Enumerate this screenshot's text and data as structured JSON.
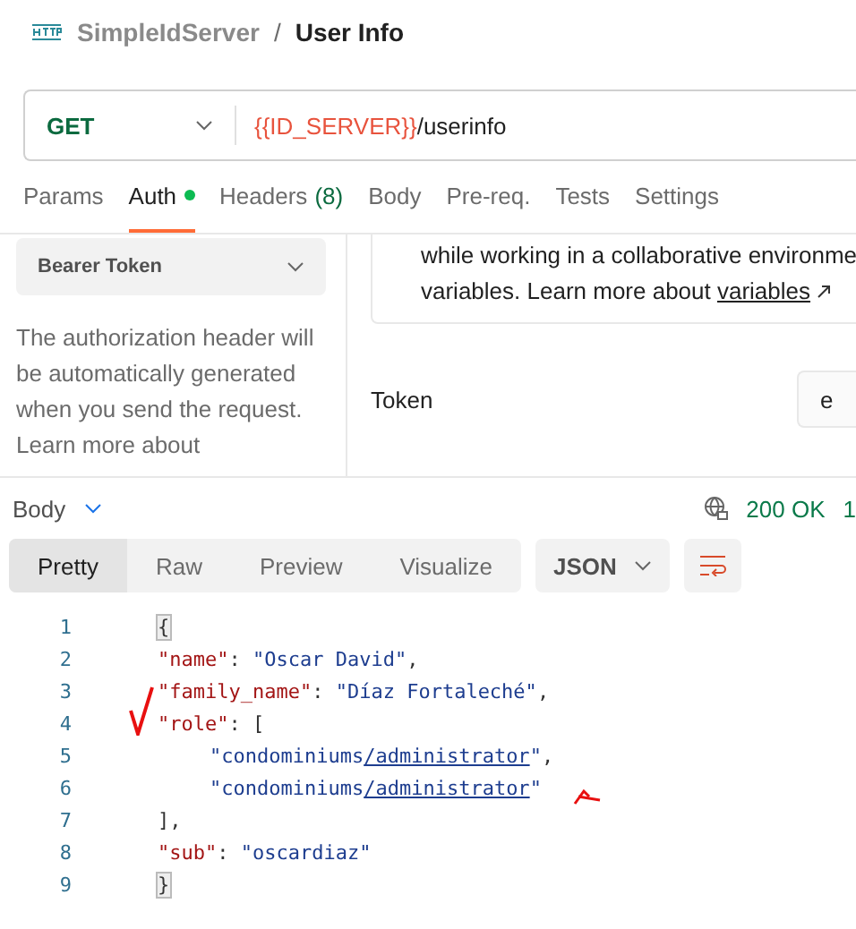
{
  "breadcrumb": {
    "collection": "SimpleIdServer",
    "separator": "/",
    "request": "User Info"
  },
  "request": {
    "method": "GET",
    "url_variable": "{{ID_SERVER}}",
    "url_path": "/userinfo"
  },
  "tabs": [
    {
      "label": "Params",
      "selected": false
    },
    {
      "label": "Auth",
      "selected": true,
      "dot": true
    },
    {
      "label": "Headers",
      "count": "(8)",
      "selected": false
    },
    {
      "label": "Body",
      "selected": false
    },
    {
      "label": "Pre-req.",
      "selected": false
    },
    {
      "label": "Tests",
      "selected": false
    },
    {
      "label": "Settings",
      "selected": false
    }
  ],
  "auth": {
    "type": "Bearer Token",
    "description": "The authorization header will be automatically generated when you send the request. Learn more about",
    "info_line_1": "while working in a collaborative environme",
    "info_line_2": "variables. Learn more about ",
    "info_link": "variables",
    "token_label": "Token",
    "token_value": "e"
  },
  "response": {
    "label": "Body",
    "status": "200 OK",
    "time": "1",
    "views": [
      {
        "label": "Pretty",
        "selected": true
      },
      {
        "label": "Raw",
        "selected": false
      },
      {
        "label": "Preview",
        "selected": false
      },
      {
        "label": "Visualize",
        "selected": false
      }
    ],
    "format": "JSON"
  },
  "code": [
    {
      "number": "1",
      "segments": [
        {
          "kind": "bracket",
          "text": "{"
        }
      ]
    },
    {
      "number": "2",
      "segments": [
        {
          "kind": "key",
          "text": "\"name\""
        },
        {
          "kind": "punct",
          "text": ": "
        },
        {
          "kind": "string",
          "text": "\"Oscar David\""
        },
        {
          "kind": "punct",
          "text": ","
        }
      ]
    },
    {
      "number": "3",
      "segments": [
        {
          "kind": "key",
          "text": "\"family_name\""
        },
        {
          "kind": "punct",
          "text": ": "
        },
        {
          "kind": "string",
          "text": "\"Díaz Fortaleché\""
        },
        {
          "kind": "punct",
          "text": ","
        }
      ]
    },
    {
      "number": "4",
      "segments": [
        {
          "kind": "key",
          "text": "\"role\""
        },
        {
          "kind": "punct",
          "text": ": ["
        }
      ],
      "children": [
        {
          "number": "5",
          "segments": [
            {
              "kind": "string",
              "text": "\"condominiums"
            },
            {
              "kind": "link",
              "text": "/administrator"
            },
            {
              "kind": "string",
              "text": "\""
            },
            {
              "kind": "punct",
              "text": ","
            }
          ]
        },
        {
          "number": "6",
          "segments": [
            {
              "kind": "string",
              "text": "\"condominiums"
            },
            {
              "kind": "link",
              "text": "/administrator"
            },
            {
              "kind": "string",
              "text": "\""
            }
          ]
        }
      ]
    },
    {
      "number": "7",
      "segments": [
        {
          "kind": "punct",
          "text": "],"
        }
      ]
    },
    {
      "number": "8",
      "segments": [
        {
          "kind": "key",
          "text": "\"sub\""
        },
        {
          "kind": "punct",
          "text": ": "
        },
        {
          "kind": "string",
          "text": "\"oscardiaz\""
        }
      ]
    },
    {
      "number": "9",
      "segments": [
        {
          "kind": "bracket",
          "text": "}"
        }
      ]
    }
  ]
}
